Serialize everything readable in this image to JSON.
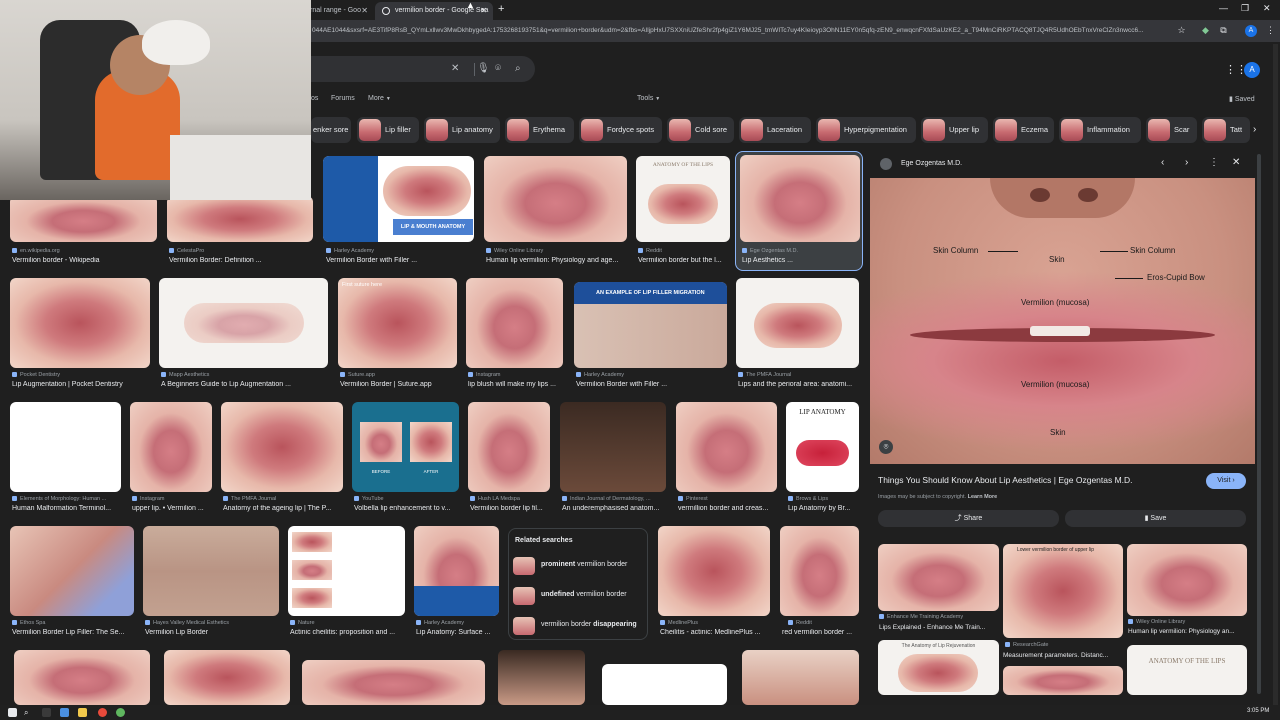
{
  "browser": {
    "tabs": [
      {
        "title": "rnal range - Goo",
        "active": false
      },
      {
        "title": "vermilion border - Google Sea",
        "active": true
      }
    ],
    "new_tab": "+",
    "url": "044AE1044&sxsrf=AE3TifP8RsB_QYmLxllwv3MwDkhbygedA:1753268193751&q=vermilion+border&udm=2&fbs=AIljpHxU7SXXniUZfeShr2fp4giZ1Y6MJ25_tmWITc7uy4KIeioyp3OhN11EY0n5qfq-zEN9_enwqcnFXfdSaUzKE2_a_T94MnCiRKPTACQ8TJQ4R5UdhOEbTnxVreClZn3nwcc6..."
  },
  "search": {
    "nav": [
      "os",
      "Forums",
      "More",
      "Tools"
    ],
    "saved": "Saved",
    "avatar": "A"
  },
  "chips": [
    "enker sore",
    "Lip filler",
    "Lip anatomy",
    "Erythema",
    "Fordyce spots",
    "Cold sore",
    "Laceration",
    "Hyperpigmentation",
    "Upper lip",
    "Eczema",
    "Inflammation",
    "Scar",
    "Tatt"
  ],
  "results": [
    {
      "source": "en.wikipedia.org",
      "title": "Vermilion border - Wikipedia"
    },
    {
      "source": "CelestaPro",
      "title": "Vermilion Border: Definition ..."
    },
    {
      "source": "Harley Academy",
      "title": "Vermilion Border with Filler ..."
    },
    {
      "source": "Wiley Online Library",
      "title": "Human lip vermilion: Physiology and age..."
    },
    {
      "source": "Reddit",
      "title": "Vermilion border but the l..."
    },
    {
      "source": "Ege Ozgentas M.D.",
      "title": "Lip Aesthetics ..."
    },
    {
      "source": "Pocket Dentistry",
      "title": "Lip Augmentation | Pocket Dentistry"
    },
    {
      "source": "Mapp Aesthetics",
      "title": "A Beginners Guide to Lip Augmentation ..."
    },
    {
      "source": "Suture.app",
      "title": "Vermilion Border | Suture.app"
    },
    {
      "source": "Instagram",
      "title": "lip blush will make my lips ..."
    },
    {
      "source": "Harley Academy",
      "title": "Vermilion Border with Filler ..."
    },
    {
      "source": "The PMFA Journal",
      "title": "Lips and the perioral area: anatomi..."
    },
    {
      "source": "Elements of Morphology: Human ...",
      "title": "Human Malformation Terminol..."
    },
    {
      "source": "Instagram",
      "title": "upper lip. • Vermilion ..."
    },
    {
      "source": "The PMFA Journal",
      "title": "Anatomy of the ageing lip | The P..."
    },
    {
      "source": "YouTube",
      "title": "Volbella lip enhancement to v..."
    },
    {
      "source": "Hush LA Medspa",
      "title": "Vermilion border lip fil..."
    },
    {
      "source": "Indian Journal of Dermatology, ...",
      "title": "An underemphasised anatom..."
    },
    {
      "source": "Pinterest",
      "title": "vermillion border and creas..."
    },
    {
      "source": "Brows & Lips",
      "title": "Lip Anatomy by Br..."
    },
    {
      "source": "Ethos Spa",
      "title": "Vermilion Border Lip Filler: The Se..."
    },
    {
      "source": "Hayes Valley Medical Esthetics",
      "title": "Vermilion Lip Border"
    },
    {
      "source": "Nature",
      "title": "Actinic cheilitis: proposition and ..."
    },
    {
      "source": "Harley Academy",
      "title": "Lip Anatomy: Surface ..."
    },
    {
      "source": "MedlinePlus",
      "title": "Cheilitis - actinic: MedlinePlus ..."
    },
    {
      "source": "Reddit",
      "title": "red vermilion border ..."
    }
  ],
  "image_texts": {
    "lip_mouth_anatomy": "LIP & MOUTH ANATOMY",
    "lip_filler_migration": "AN EXAMPLE OF LIP FILLER MIGRATION",
    "anatomy_of_the_lips": "ANATOMY OF THE LIPS",
    "lip_anatomy": "LIP ANATOMY",
    "first_suture": "First suture here",
    "before": "BEFORE",
    "after": "AFTER"
  },
  "related": {
    "heading": "Related searches",
    "items": [
      {
        "bold": "prominent",
        "rest": " vermilion border"
      },
      {
        "bold": "undefined",
        "rest": " vermilion border"
      },
      {
        "bold": "disappearing",
        "rest": "vermilion border "
      }
    ]
  },
  "panel": {
    "source": "Ege Ozgentas M.D.",
    "labels": {
      "skin_column_left": "Skin Column",
      "skin_column_right": "Skin Column",
      "skin_top": "Skin",
      "eros_cupid_bow": "Eros-Cupid Bow",
      "vermilion_upper": "Vermilion (mucosa)",
      "vermilion_lower": "Vermilion (mucosa)",
      "skin_bottom": "Skin"
    },
    "title": "Things You Should Know About Lip Aesthetics | Ege Ozgentas M.D.",
    "visit": "Visit",
    "copyright_prefix": "Images may be subject to copyright.",
    "learn_more": "Learn More",
    "share": "Share",
    "save": "Save",
    "more_results": [
      {
        "source": "Enhance Me Training Academy",
        "title": "Lips Explained - Enhance Me Train..."
      },
      {
        "source": "ResearchGate",
        "title": "Measurement parameters. Distanc..."
      },
      {
        "source": "Wiley Online Library",
        "title": "Human lip vermilion: Physiology an..."
      }
    ],
    "more_image_texts": {
      "lower_vermilion": "Lower vermilion border of upper lip",
      "anatomy_lip_rejuvenation": "The Anatomy of Lip Rejuvenation",
      "anatomy_of_the_lips": "ANATOMY OF THE LIPS"
    }
  },
  "taskbar": {
    "clock": "3:05 PM"
  },
  "colors": {
    "background": "#1f1f1f",
    "accent": "#8ab4f8",
    "chip": "#303134",
    "visit": "#8ab4f8"
  }
}
